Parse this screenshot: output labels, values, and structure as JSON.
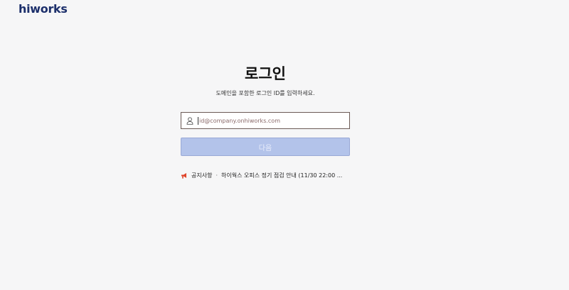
{
  "header": {
    "logo_text": "hiworks"
  },
  "login": {
    "title": "로그인",
    "subtitle": "도메인을 포함한 로그인 ID를 입력하세요.",
    "id_field": {
      "value": "",
      "placeholder": "id@company.onhiworks.com",
      "icon": "user-icon"
    },
    "next_button_label": "다음"
  },
  "notice": {
    "icon": "megaphone-icon",
    "label": "공지사항",
    "separator": "·",
    "text": "하이웍스 오피스 정기 점검 안내 (11/30 22:00 ..."
  },
  "colors": {
    "brand": "#1c2f6b",
    "button_bg": "#b3c3ea",
    "button_text": "#e9eefb",
    "notice_icon": "#e0452b"
  }
}
